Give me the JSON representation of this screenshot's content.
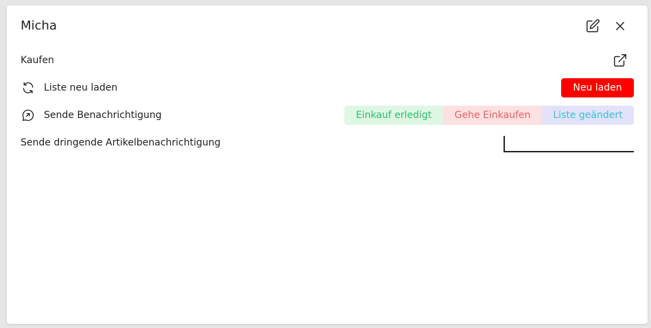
{
  "dialog": {
    "title": "Micha"
  },
  "icons": {
    "edit": "edit-icon",
    "close": "close-icon",
    "external": "external-link-icon",
    "refresh": "refresh-icon",
    "message": "chat-arrow-icon"
  },
  "rows": {
    "buy_label": "Kaufen",
    "reload_label": "Liste neu laden",
    "reload_button": "Neu laden",
    "notify_label": "Sende Benachrichtigung",
    "urgent_label": "Sende dringende Artikelbenachrichtigung"
  },
  "notifications": [
    {
      "label": "Einkauf erledigt",
      "bg": "#ddf7e3",
      "fg": "#2ebd72"
    },
    {
      "label": "Gehe Einkaufen",
      "bg": "#fde0e0",
      "fg": "#e06565"
    },
    {
      "label": "Liste geändert",
      "bg": "#e2e2fb",
      "fg": "#3cc0cf"
    }
  ],
  "urgent_input": {
    "value": "",
    "placeholder": ""
  },
  "colors": {
    "reload_bg": "#ff0000",
    "reload_fg": "#ffffff"
  }
}
